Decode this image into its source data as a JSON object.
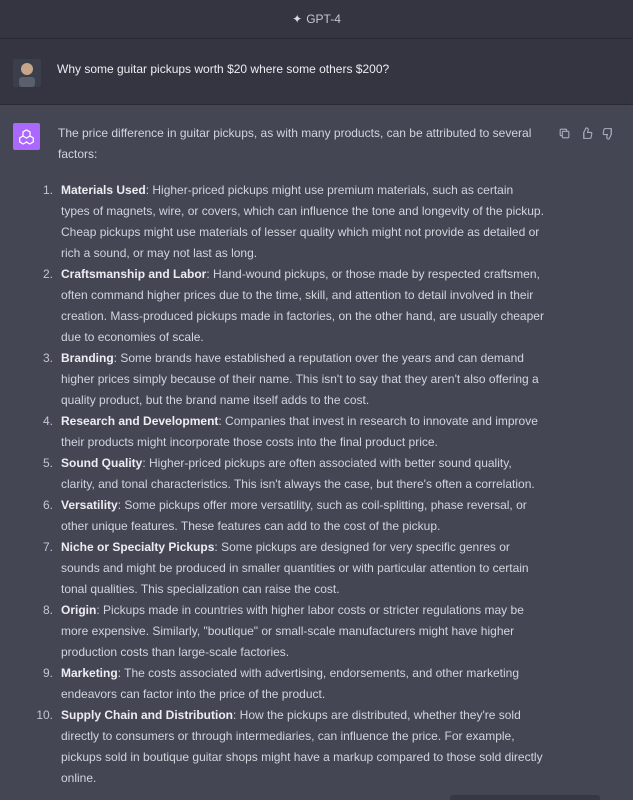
{
  "header": {
    "model_name": "GPT-4",
    "sparkle_icon": "sparkle-icon"
  },
  "user_message": {
    "avatar": "user-avatar",
    "text": "Why some guitar pickups worth $20 where some others $200?"
  },
  "assistant_message": {
    "avatar": "openai-logo-icon",
    "intro": "The price difference in guitar pickups, as with many products, can be attributed to several factors:",
    "actions": {
      "copy_icon": "copy-icon",
      "thumbs_up_icon": "thumbs-up-icon",
      "thumbs_down_icon": "thumbs-down-icon"
    },
    "items": [
      {
        "num": "1.",
        "title": "Materials Used",
        "text": ": Higher-priced pickups might use premium materials, such as certain types of magnets, wire, or covers, which can influence the tone and longevity of the pickup. Cheap pickups might use materials of lesser quality which might not provide as detailed or rich a sound, or may not last as long."
      },
      {
        "num": "2.",
        "title": "Craftsmanship and Labor",
        "text": ": Hand-wound pickups, or those made by respected craftsmen, often command higher prices due to the time, skill, and attention to detail involved in their creation. Mass-produced pickups made in factories, on the other hand, are usually cheaper due to economies of scale."
      },
      {
        "num": "3.",
        "title": "Branding",
        "text": ": Some brands have established a reputation over the years and can demand higher prices simply because of their name. This isn't to say that they aren't also offering a quality product, but the brand name itself adds to the cost."
      },
      {
        "num": "4.",
        "title": "Research and Development",
        "text": ": Companies that invest in research to innovate and improve their products might incorporate those costs into the final product price."
      },
      {
        "num": "5.",
        "title": "Sound Quality",
        "text": ": Higher-priced pickups are often associated with better sound quality, clarity, and tonal characteristics. This isn't always the case, but there's often a correlation."
      },
      {
        "num": "6.",
        "title": "Versatility",
        "text": ": Some pickups offer more versatility, such as coil-splitting, phase reversal, or other unique features. These features can add to the cost of the pickup."
      },
      {
        "num": "7.",
        "title": "Niche or Specialty Pickups",
        "text": ": Some pickups are designed for very specific genres or sounds and might be produced in smaller quantities or with particular attention to certain tonal qualities. This specialization can raise the cost."
      },
      {
        "num": "8.",
        "title": "Origin",
        "text": ": Pickups made in countries with higher labor costs or stricter regulations may be more expensive. Similarly, \"boutique\" or small-scale manufacturers might have higher production costs than large-scale factories."
      },
      {
        "num": "9.",
        "title": "Marketing",
        "text": ": The costs associated with advertising, endorsements, and other marketing endeavors can factor into the price of the product."
      },
      {
        "num": "10.",
        "title": "Supply Chain and Distribution",
        "text": ": How the pickups are distributed, whether they're sold directly to consumers or through intermediaries, can influence the price. For example, pickups sold in boutique guitar shops might have a markup compared to those sold directly online."
      }
    ]
  },
  "colors": {
    "header_bg": "#343541",
    "assistant_bg": "#444654",
    "gpt_avatar_bg": "#ab68ff",
    "text": "#d1d5db"
  }
}
